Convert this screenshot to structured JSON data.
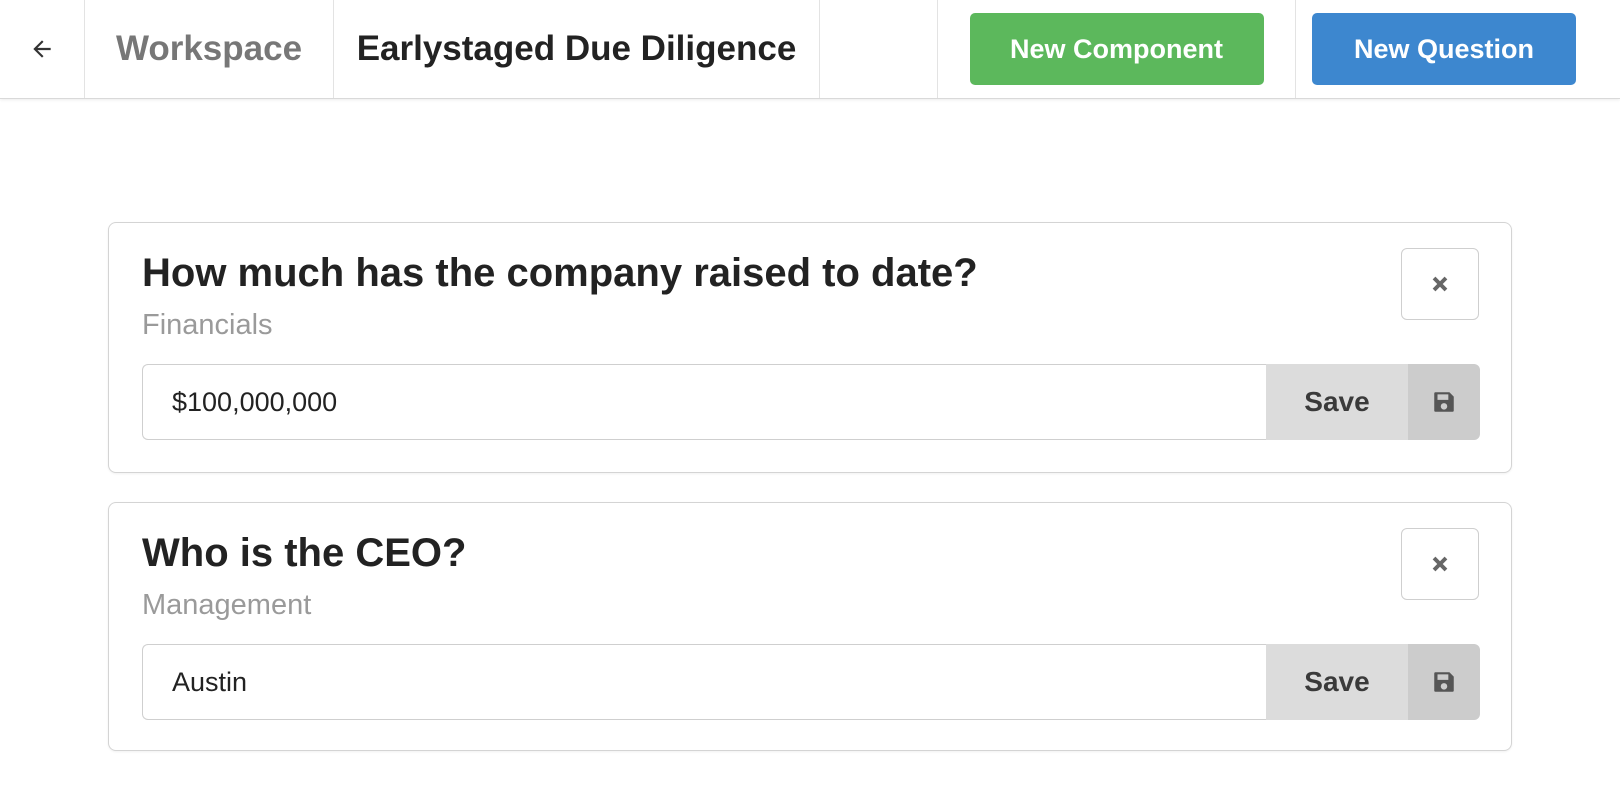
{
  "header": {
    "back_icon": "arrow-left-icon",
    "workspace_label": "Workspace",
    "title": "Earlystaged Due Diligence",
    "new_component_label": "New Component",
    "new_question_label": "New Question"
  },
  "questions": [
    {
      "title": "How much has the company raised to date?",
      "category": "Financials",
      "answer": "$100,000,000",
      "save_label": "Save",
      "close_icon": "close-icon",
      "save_icon": "floppy-disk-icon"
    },
    {
      "title": "Who is the CEO?",
      "category": "Management",
      "answer": "Austin",
      "save_label": "Save",
      "close_icon": "close-icon",
      "save_icon": "floppy-disk-icon"
    }
  ],
  "colors": {
    "green": "#5cb85c",
    "blue": "#3d87cf",
    "muted_text": "#9a9a9a",
    "save_bg": "#dcdcdc"
  }
}
